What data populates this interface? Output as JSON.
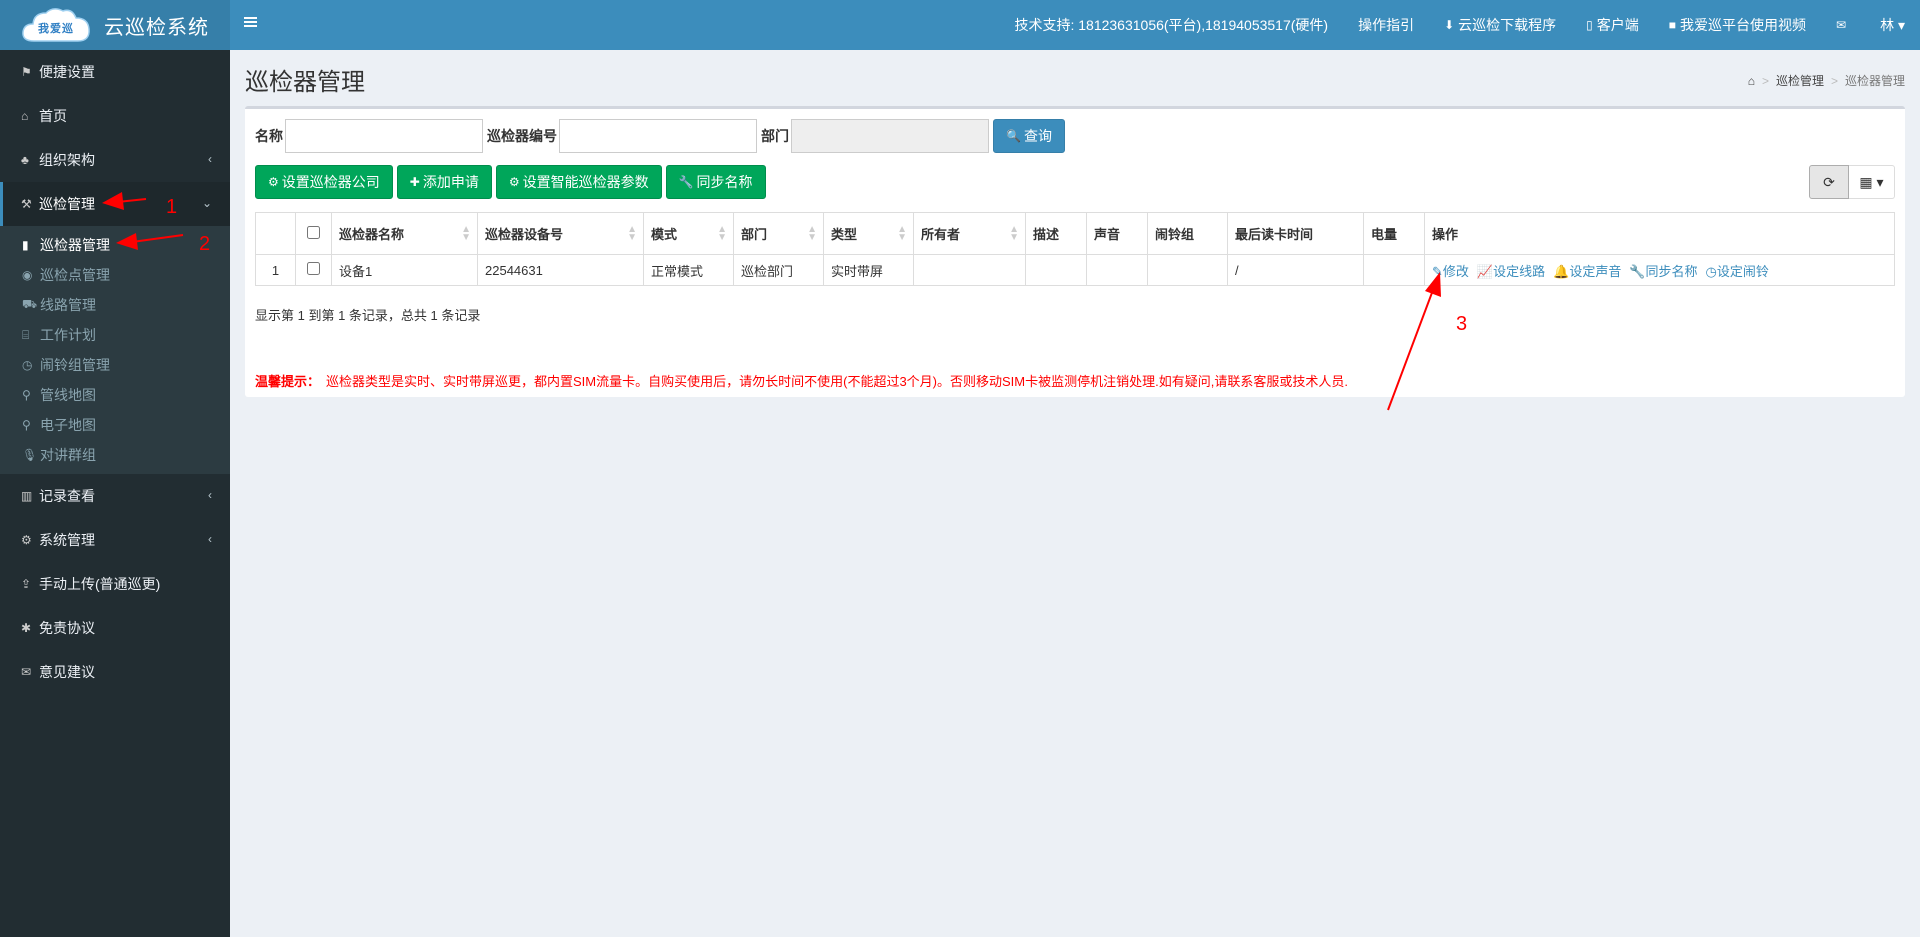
{
  "logo": {
    "cloud_text": "我爱巡",
    "title": "云巡检系统"
  },
  "topnav": [
    {
      "icon": "",
      "label": "技术支持: 18123631056(平台),18194053517(硬件)"
    },
    {
      "icon": "",
      "label": "操作指引"
    },
    {
      "icon": "⬇",
      "label": "云巡检下载程序"
    },
    {
      "icon": "▯",
      "label": "客户端"
    },
    {
      "icon": "■",
      "label": "我爱巡平台使用视频"
    },
    {
      "icon": "✉",
      "label": ""
    },
    {
      "icon": "",
      "label": "林 ▾"
    }
  ],
  "sidebar": {
    "items": [
      {
        "label": "便捷设置",
        "icon": "⚑"
      },
      {
        "label": "首页",
        "icon": "⌂"
      },
      {
        "label": "组织架构",
        "icon": "♣",
        "chevron": "‹"
      },
      {
        "label": "巡检管理",
        "icon": "⚒",
        "chevron": "⌄"
      }
    ],
    "submenu": [
      {
        "label": "巡检器管理",
        "icon": "▮"
      },
      {
        "label": "巡检点管理",
        "icon": "◉"
      },
      {
        "label": "线路管理",
        "icon": "⛟"
      },
      {
        "label": "工作计划",
        "icon": "⌸"
      },
      {
        "label": "闹铃组管理",
        "icon": "◷"
      },
      {
        "label": "管线地图",
        "icon": "⚲"
      },
      {
        "label": "电子地图",
        "icon": "⚲"
      },
      {
        "label": "对讲群组",
        "icon": "🎙"
      }
    ],
    "items_after": [
      {
        "label": "记录查看",
        "icon": "▥",
        "chevron": "‹"
      },
      {
        "label": "系统管理",
        "icon": "⚙",
        "chevron": "‹"
      },
      {
        "label": "手动上传(普通巡更)",
        "icon": "⇪"
      },
      {
        "label": "免责协议",
        "icon": "✱"
      },
      {
        "label": "意见建议",
        "icon": "✉"
      }
    ]
  },
  "content": {
    "title": "巡检器管理",
    "breadcrumb": [
      "巡检管理",
      "巡检器管理"
    ]
  },
  "search": {
    "name_label": "名称",
    "name_value": "",
    "code_label": "巡检器编号",
    "code_value": "",
    "dept_label": "部门",
    "dept_value": "",
    "query_label": "查询"
  },
  "toolbar": {
    "set_company": "设置巡检器公司",
    "add_apply": "添加申请",
    "set_smart_params": "设置智能巡检器参数",
    "sync_name": "同步名称"
  },
  "table": {
    "headers": [
      "",
      "",
      "巡检器名称",
      "巡检器设备号",
      "模式",
      "部门",
      "类型",
      "所有者",
      "描述",
      "声音",
      "闹铃组",
      "最后读卡时间",
      "电量",
      "操作"
    ],
    "rows": [
      {
        "index": "1",
        "name": "设备1",
        "device_no": "22544631",
        "mode": "正常模式",
        "dept": "巡检部门",
        "type": "实时带屏",
        "owner": "",
        "desc": "",
        "sound": "",
        "alarm_group": "",
        "last_read": "/",
        "battery": ""
      }
    ],
    "actions": [
      "修改",
      "设定线路",
      "设定声音",
      "同步名称",
      "设定闹铃"
    ]
  },
  "pagination_info": "显示第 1 到第 1 条记录，总共 1 条记录",
  "notice": {
    "label": "温馨提示：",
    "text": "巡检器类型是实时、实时带屏巡更，都内置SIM流量卡。自购买使用后，请勿长时间不使用(不能超过3个月)。否则移动SIM卡被监测停机注销处理.如有疑问,请联系客服或技术人员."
  },
  "annotations": [
    "1",
    "2",
    "3"
  ],
  "colors": {
    "header": "#3c8dbc",
    "sidebar": "#222d32",
    "success": "#00a65a",
    "annotation": "#ff0000"
  }
}
